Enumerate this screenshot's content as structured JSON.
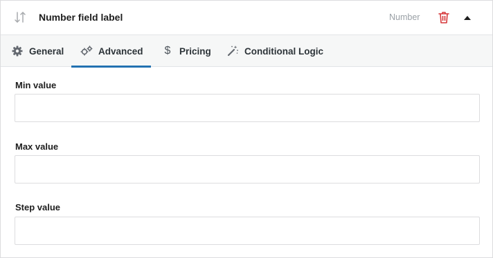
{
  "header": {
    "title": "Number field label",
    "type_label": "Number",
    "icons": {
      "sort": "sort-arrows-icon",
      "delete": "trash-icon",
      "collapse": "caret-up-icon"
    }
  },
  "tabs": [
    {
      "label": "General",
      "icon": "gear-icon",
      "active": false
    },
    {
      "label": "Advanced",
      "icon": "gears-icon",
      "active": true
    },
    {
      "label": "Pricing",
      "icon": "dollar-icon",
      "active": false
    },
    {
      "label": "Conditional Logic",
      "icon": "magic-wand-icon",
      "active": false
    }
  ],
  "fields": {
    "min": {
      "label": "Min value",
      "value": ""
    },
    "max": {
      "label": "Max value",
      "value": ""
    },
    "step": {
      "label": "Step value",
      "value": ""
    }
  },
  "colors": {
    "accent": "#2271b1",
    "danger": "#d63638",
    "muted": "#9aa0a6"
  }
}
